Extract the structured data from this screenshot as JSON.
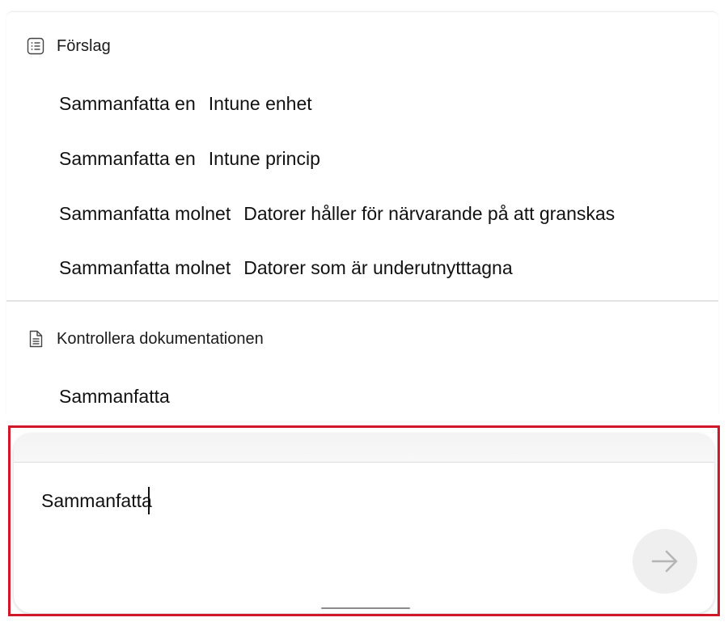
{
  "suggestions_section": {
    "icon": "list-icon",
    "title": "Förslag",
    "items": [
      {
        "part1": "Sammanfatta en",
        "part2": "Intune enhet"
      },
      {
        "part1": "Sammanfatta en",
        "part2": "Intune princip"
      },
      {
        "part1": "Sammanfatta molnet",
        "part2": "Datorer håller för närvarande på att granskas"
      },
      {
        "part1": "Sammanfatta molnet",
        "part2": "Datorer som är underutnytttagna"
      }
    ]
  },
  "docs_section": {
    "icon": "document-icon",
    "title": "Kontrollera dokumentationen",
    "items": [
      {
        "label": "Sammanfatta"
      }
    ]
  },
  "composer": {
    "value": "Sammanfatta",
    "send_icon": "arrow-right-icon",
    "highlight_color": "#d0182a"
  }
}
